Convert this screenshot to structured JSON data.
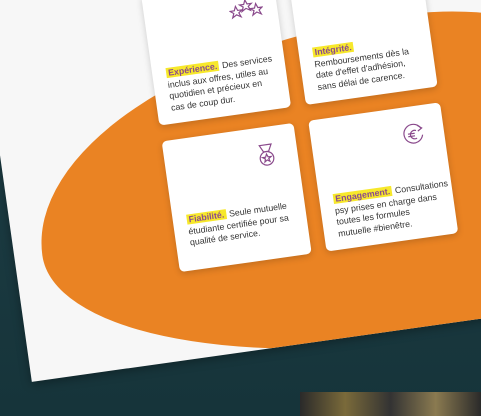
{
  "colors": {
    "accent": "#ea8323",
    "highlight": "#f7e82b",
    "icon": "#8a4a8c",
    "background_dark": "#1f3f47"
  },
  "cards": [
    {
      "icon": "three-stars-icon",
      "title": "Expérience.",
      "body": "Des services inclus aux offres, utiles au quotidien et précieux en cas de coup dur."
    },
    {
      "icon": "handshake-icon",
      "title": "Intégrité.",
      "body": "Remboursements dès la date d'effet d'adhésion, sans délai de carence."
    },
    {
      "icon": "medal-icon",
      "title": "Fiabilité.",
      "body": "Seule mutuelle étudiante certifiée pour sa qualité de service."
    },
    {
      "icon": "euro-cycle-icon",
      "title": "Engagement.",
      "body": "Consultations psy prises en charge dans toutes les formules mutuelle #bienêtre."
    }
  ]
}
